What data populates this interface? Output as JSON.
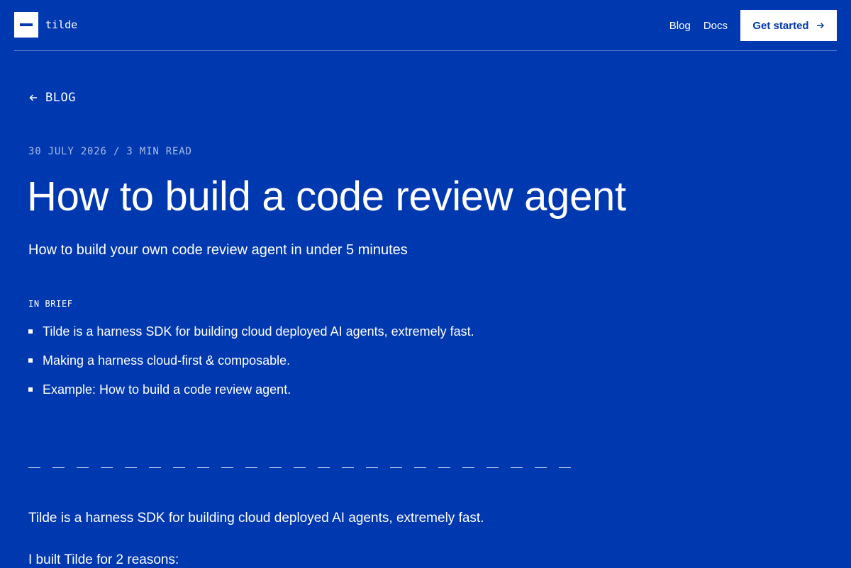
{
  "header": {
    "logo_text": "tilde",
    "nav": [
      {
        "label": "Blog"
      },
      {
        "label": "Docs"
      }
    ],
    "cta_label": "Get started"
  },
  "back_link": {
    "label": "BLOG"
  },
  "article": {
    "meta": "30 JULY 2026 / 3 MIN READ",
    "title": "How to build a code review agent",
    "subtitle": "How to build your own code review agent in under 5 minutes",
    "brief_label": "IN BRIEF",
    "brief_items": [
      "Tilde is a harness SDK for building cloud deployed AI agents, extremely fast.",
      "Making a harness cloud-first & composable.",
      "Example: How to build a code review agent."
    ],
    "body": [
      "Tilde is a harness SDK for building cloud deployed AI agents, extremely fast.",
      "I built Tilde for 2 reasons:"
    ]
  },
  "colors": {
    "background": "#0038b0",
    "text": "#ffffff",
    "button_bg": "#ffffff",
    "button_text": "#0038b0"
  },
  "icons": {
    "logo": "dash-logo-icon",
    "cta": "arrow-right-icon",
    "back": "arrow-left-icon"
  }
}
